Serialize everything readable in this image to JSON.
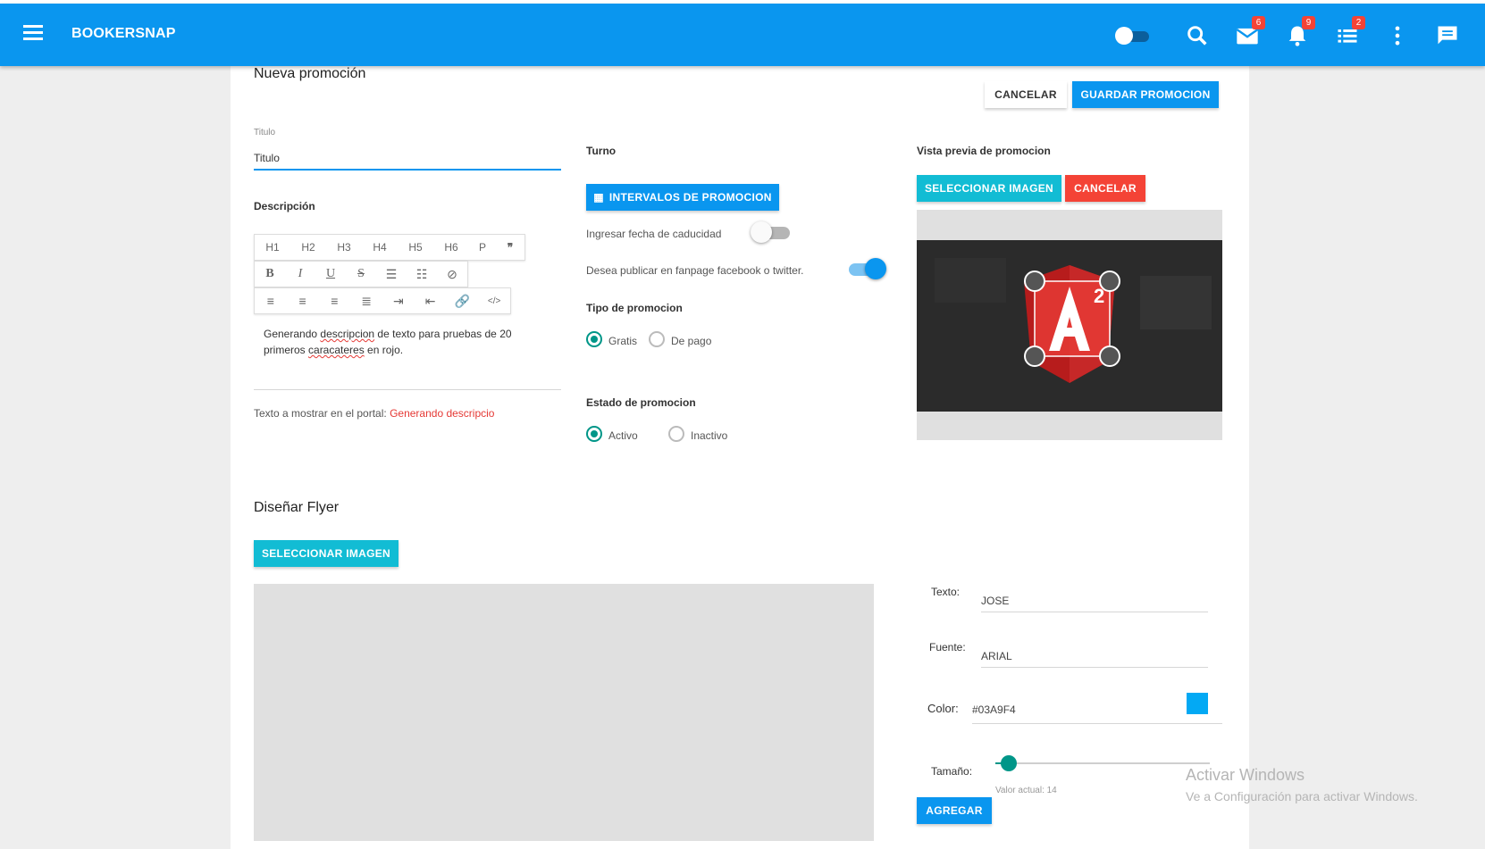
{
  "app": {
    "brand": "BOOKERSNAP"
  },
  "appbar": {
    "badges": {
      "mail": "6",
      "notifications": "9",
      "list": "2"
    }
  },
  "page": {
    "title": "Nueva promoción",
    "cancel_label": "CANCELAR",
    "save_label": "GUARDAR PROMOCION"
  },
  "form": {
    "titulo_label": "Titulo",
    "titulo_value": "Titulo",
    "descripcion_label": "Descripción",
    "toolbar_headings": [
      "H1",
      "H2",
      "H3",
      "H4",
      "H5",
      "H6",
      "P",
      "❞"
    ],
    "description_text_1": "Generando ",
    "description_text_word1": "descripcion",
    "description_text_2": " de texto para pruebas de 20",
    "description_text_3": "primeros ",
    "description_text_word2": "caracateres",
    "description_text_4": " en rojo.",
    "portal_label": "Texto a mostrar en el portal: ",
    "portal_value": "Generando descripcio"
  },
  "turno": {
    "label": "Turno",
    "intervals_button": "INTERVALOS DE PROMOCION",
    "caducidad_label": "Ingresar fecha de caducidad",
    "caducidad_on": false,
    "publicar_label": "Desea publicar en fanpage facebook o twitter.",
    "publicar_on": true,
    "tipo_label": "Tipo de promocion",
    "tipo_options": [
      "Gratis",
      "De pago"
    ],
    "tipo_selected": "Gratis",
    "estado_label": "Estado de promocion",
    "estado_options": [
      "Activo",
      "Inactivo"
    ],
    "estado_selected": "Activo"
  },
  "preview": {
    "label": "Vista previa de promocion",
    "select_image": "SELECCIONAR IMAGEN",
    "cancel": "CANCELAR"
  },
  "flyer": {
    "title": "Diseñar Flyer",
    "select_image": "SELECCIONAR IMAGEN",
    "texto_label": "Texto:",
    "texto_value": "JOSE",
    "fuente_label": "Fuente:",
    "fuente_value": "ARIAL",
    "color_label": "Color:",
    "color_value": "#03A9F4",
    "tamano_label": "Tamaño:",
    "tamano_value": 14,
    "tamano_caption": "Valor actual: 14",
    "add_button": "AGREGAR"
  },
  "watermark": {
    "title": "Activar Windows",
    "subtitle": "Ve a Configuración para activar Windows."
  },
  "colors": {
    "primary": "#0a96ef",
    "cyan": "#12bcd4",
    "danger": "#f44336",
    "teal": "#009688",
    "swatch": "#03A9F4"
  }
}
